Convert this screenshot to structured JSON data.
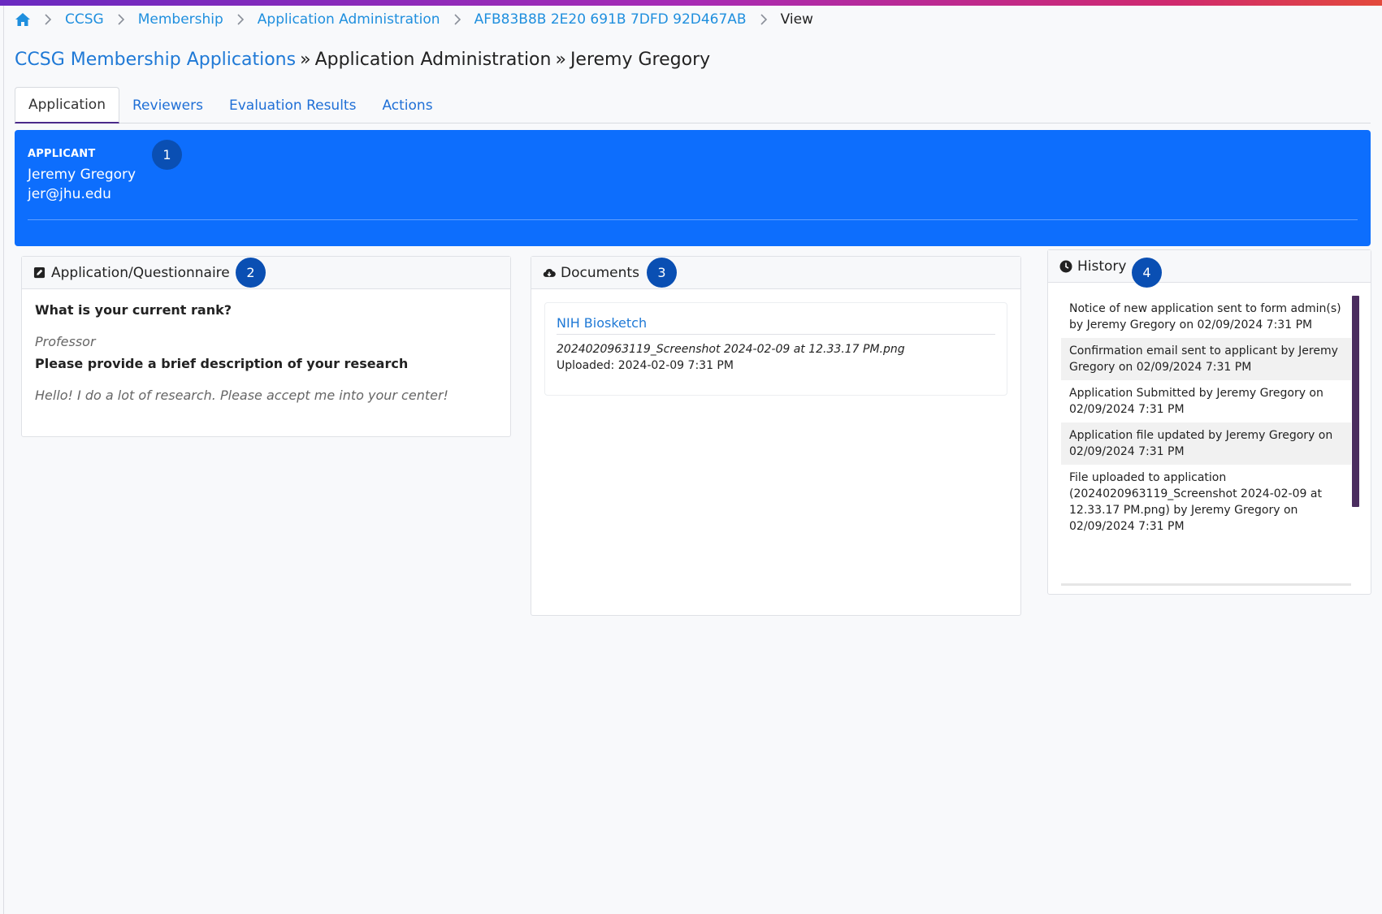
{
  "breadcrumb": {
    "home_icon": "home-icon",
    "items": [
      "CCSG",
      "Membership",
      "Application Administration",
      "AFB83B8B 2E20 691B 7DFD 92D467AB"
    ],
    "current": "View"
  },
  "title": {
    "link": "CCSG Membership Applications",
    "separator": "»",
    "section": "Application Administration",
    "applicant": "Jeremy Gregory"
  },
  "tabs": [
    {
      "label": "Application",
      "active": true
    },
    {
      "label": "Reviewers",
      "active": false
    },
    {
      "label": "Evaluation Results",
      "active": false
    },
    {
      "label": "Actions",
      "active": false
    }
  ],
  "applicant": {
    "label": "APPLICANT",
    "name": "Jeremy Gregory",
    "email": "jer@jhu.edu"
  },
  "badges": [
    "1",
    "2",
    "3",
    "4"
  ],
  "questionnaire": {
    "header": "Application/Questionnaire",
    "icon": "edit-square-icon",
    "items": [
      {
        "question": "What is your current rank?",
        "answer": "Professor"
      },
      {
        "question": "Please provide a brief description of your research",
        "answer": "Hello! I do a lot of research. Please accept me into your center!"
      }
    ]
  },
  "documents": {
    "header": "Documents",
    "icon": "cloud-download-icon",
    "items": [
      {
        "title": "NIH Biosketch",
        "file": "2024020963119_Screenshot 2024-02-09 at 12.33.17 PM.png",
        "uploaded": "Uploaded: 2024-02-09 7:31 PM"
      }
    ]
  },
  "history": {
    "header": "History",
    "icon": "clock-icon",
    "items": [
      "Notice of new application sent to form admin(s) by Jeremy Gregory on 02/09/2024 7:31 PM",
      "Confirmation email sent to applicant by Jeremy Gregory on 02/09/2024 7:31 PM",
      "Application Submitted by Jeremy Gregory on 02/09/2024 7:31 PM",
      "Application file updated by Jeremy Gregory on 02/09/2024 7:31 PM",
      "File uploaded to application (2024020963119_Screenshot 2024-02-09 at 12.33.17 PM.png) by Jeremy Gregory on 02/09/2024 7:31 PM"
    ]
  },
  "colors": {
    "banner": "#0d6efd",
    "badge": "#0a4fb3",
    "link": "#1f79d6",
    "scrollbar": "#4b2d5f"
  }
}
